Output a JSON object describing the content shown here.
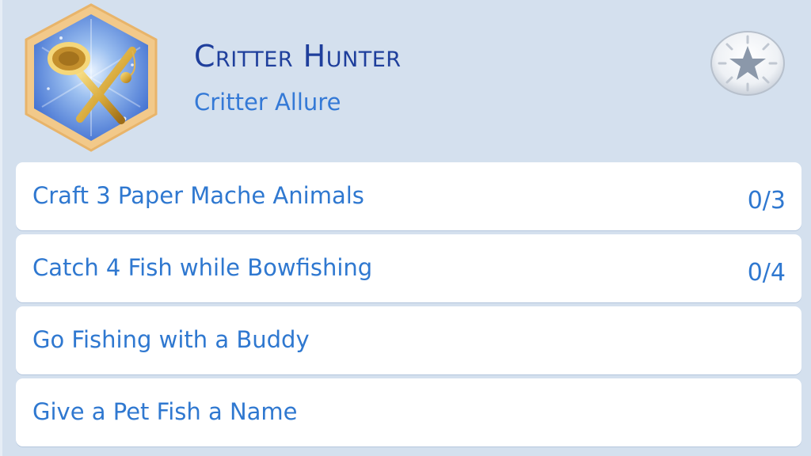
{
  "aspiration": {
    "title": "Critter Hunter",
    "subtitle": "Critter Allure",
    "badge_icon": "net-and-fishing-rod-icon",
    "action_icon": "star-icon"
  },
  "tasks": [
    {
      "label": "Craft 3 Paper Mache Animals",
      "progress": "0/3"
    },
    {
      "label": "Catch 4 Fish while Bowfishing",
      "progress": "0/4"
    },
    {
      "label": "Go Fishing with a Buddy",
      "progress": ""
    },
    {
      "label": "Give a Pet Fish a Name",
      "progress": ""
    }
  ],
  "colors": {
    "panel_bg": "#d4e0ee",
    "title": "#1f3f9c",
    "accent": "#3479d6",
    "badge_border": "#f3cf8f",
    "badge_fill": "#5a86d8"
  }
}
